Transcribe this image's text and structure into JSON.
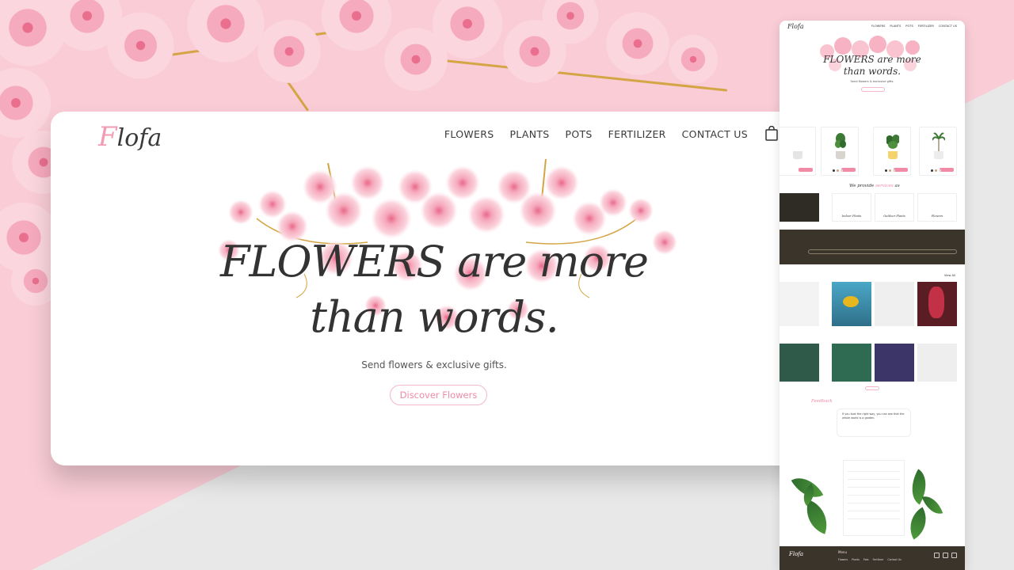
{
  "logo": {
    "first_letter": "F",
    "rest": "lofa"
  },
  "nav": {
    "items": [
      {
        "label": "FLOWERS"
      },
      {
        "label": "PLANTS"
      },
      {
        "label": "POTS"
      },
      {
        "label": "FERTILIZER"
      },
      {
        "label": "CONTACT US"
      }
    ],
    "cart_icon": "shopping-bag-icon"
  },
  "hero": {
    "title_line1": "FLOWERS are more",
    "title_line2": "than words.",
    "subtitle": "Send flowers & exclusive gifts.",
    "button_label": "Discover Flowers"
  },
  "preview": {
    "logo": "Flofa",
    "nav": [
      "FLOWERS",
      "PLANTS",
      "POTS",
      "FERTILIZER",
      "CONTACT US"
    ],
    "hero_title_line1": "FLOWERS are more",
    "hero_title_line2": "than words.",
    "hero_subtitle": "Send flowers & exclusive gifts.",
    "services_heading_start": "We provide",
    "services_heading_pink": "services",
    "services_heading_end": "as",
    "services": [
      "Indoor Plants",
      "Outdoor Plants",
      "Flowers"
    ],
    "view_all": "View All",
    "feedback_label": "Feedback",
    "quote": "If you look the right way, you can see that the whole world is a garden.",
    "menu_label": "Menu",
    "footer_links": [
      "Flowers",
      "Plants",
      "Pots",
      "Fertilizer",
      "Contact Us"
    ]
  },
  "colors": {
    "accent_pink": "#f08aa5",
    "background_pink": "#f9ccd6",
    "dark_band": "#3a342b"
  }
}
